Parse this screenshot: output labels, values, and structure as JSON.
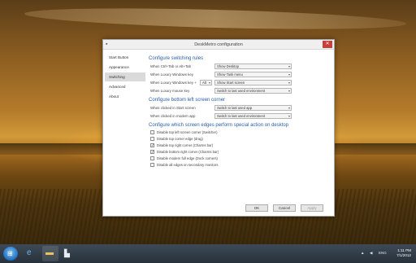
{
  "dialog": {
    "title": "DeskMetro configuration",
    "close_symbol": "✕"
  },
  "sidebar": {
    "items": [
      {
        "label": "Start Button"
      },
      {
        "label": "Appearance"
      },
      {
        "label": "Switching"
      },
      {
        "label": "Advanced"
      },
      {
        "label": "About"
      }
    ]
  },
  "switching": {
    "heading": "Configure switching rules",
    "rows": [
      {
        "label": "When Ctrl+Tab or Alt+Tab",
        "value": "Show Desktop"
      },
      {
        "label": "When Luxury Windows key",
        "value": "Show Task menu"
      },
      {
        "label": "When Luxury Windows key +",
        "key": "Alt",
        "value": "Show Start screen"
      },
      {
        "label": "When Luxury mouse key",
        "value": "Switch to last used environment"
      }
    ]
  },
  "corners": {
    "heading": "Configure bottom left screen corner",
    "rows": [
      {
        "label": "When clicked in Start screen",
        "value": "Switch to last used app"
      },
      {
        "label": "When clicked in modern app",
        "value": "Switch to last used environment"
      }
    ]
  },
  "hotcorners": {
    "heading": "Configure which screen edges perform special action on desktop",
    "items": [
      {
        "label": "Disable top left screen corner (Switcher)",
        "checked": false
      },
      {
        "label": "Disable top corner edge (drag)",
        "checked": false
      },
      {
        "label": "Disable top right corner (Charms bar)",
        "checked": true
      },
      {
        "label": "Disable bottom right corner (Charms bar)",
        "checked": true
      },
      {
        "label": "Disable modern full edge (Dock corners)",
        "checked": false
      },
      {
        "label": "Disable all edges on secondary monitors",
        "checked": false
      }
    ]
  },
  "buttons": {
    "ok": "OK",
    "cancel": "Cancel",
    "apply": "Apply"
  },
  "taskbar": {
    "tray_lang": "ENG",
    "clock_time": "1:11 PM",
    "clock_date": "7/1/2012"
  },
  "colors": {
    "accent": "#2a5dab",
    "close": "#c7403a"
  }
}
